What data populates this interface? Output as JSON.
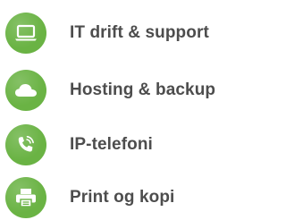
{
  "services": [
    {
      "label": "IT drift & support",
      "icon": "laptop-icon"
    },
    {
      "label": "Hosting & backup",
      "icon": "cloud-icon"
    },
    {
      "label": "IP-telefoni",
      "icon": "phone-icon"
    },
    {
      "label": "Print og kopi",
      "icon": "printer-icon"
    }
  ],
  "colors": {
    "accent": "#6ab344",
    "text": "#4d4d4d",
    "icon": "#ffffff"
  }
}
